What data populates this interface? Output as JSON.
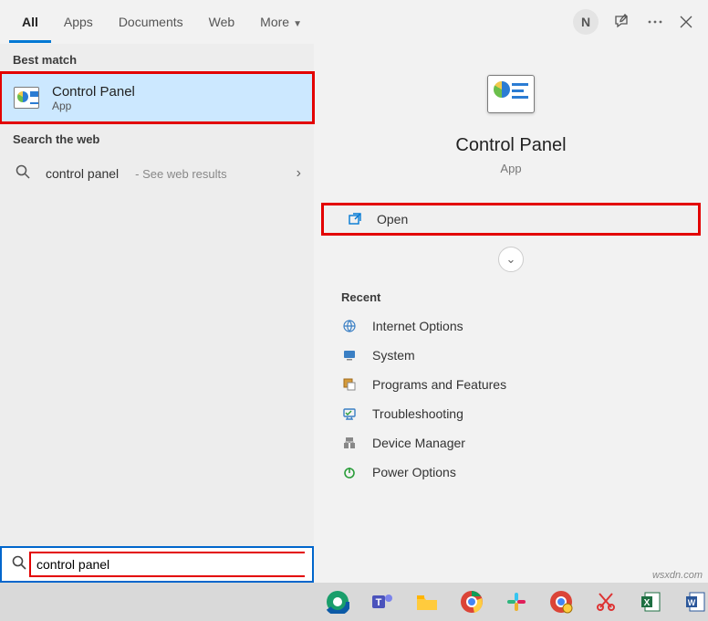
{
  "tabs": {
    "all": "All",
    "apps": "Apps",
    "documents": "Documents",
    "web": "Web",
    "more": "More"
  },
  "user_initial": "N",
  "left": {
    "best_match_hdr": "Best match",
    "best_match": {
      "title": "Control Panel",
      "subtitle": "App"
    },
    "web_hdr": "Search the web",
    "web_query": "control panel",
    "web_hint": "- See web results"
  },
  "right": {
    "title": "Control Panel",
    "subtitle": "App",
    "open": "Open",
    "recent_hdr": "Recent",
    "recent": [
      "Internet Options",
      "System",
      "Programs and Features",
      "Troubleshooting",
      "Device Manager",
      "Power Options"
    ]
  },
  "search_value": "control panel",
  "watermark": "wsxdn.com"
}
